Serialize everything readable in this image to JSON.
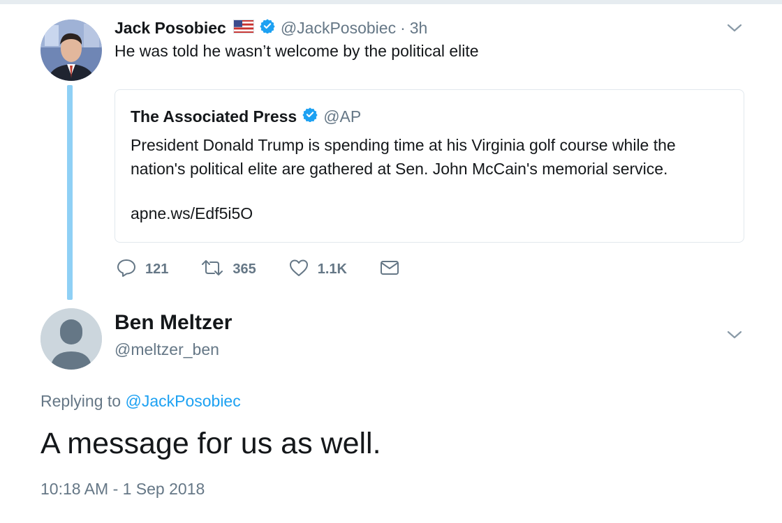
{
  "tweet": {
    "author_name": "Jack Posobiec",
    "author_handle": "@JackPosobiec",
    "separator": "·",
    "time": "3h",
    "text": "He was told he wasn’t welcome by the political elite",
    "icons": {
      "flag": "us-flag-icon",
      "verified": "verified-badge-icon",
      "more": "chevron-down-icon"
    },
    "quoted": {
      "author_name": "The Associated Press",
      "author_handle": "@AP",
      "text": "President Donald Trump is spending time at his Virginia golf course while the nation's political elite are gathered at Sen. John McCain's memorial service.",
      "link": "apne.ws/Edf5i5O"
    },
    "actions": {
      "replies": "121",
      "retweets": "365",
      "likes": "1.1K",
      "icons": [
        "reply-icon",
        "retweet-icon",
        "like-icon",
        "message-icon"
      ]
    }
  },
  "reply": {
    "author_name": "Ben Meltzer",
    "author_handle": "@meltzer_ben",
    "replying_prefix": "Replying to",
    "replying_to": "@JackPosobiec",
    "text": "A message for us as well.",
    "timestamp": "10:18 AM - 1 Sep 2018"
  },
  "colors": {
    "accent": "#1da1f2",
    "thread_line": "#8fd0f5",
    "secondary_text": "#657786",
    "primary_text": "#14171a",
    "border": "#e1e8ed"
  }
}
